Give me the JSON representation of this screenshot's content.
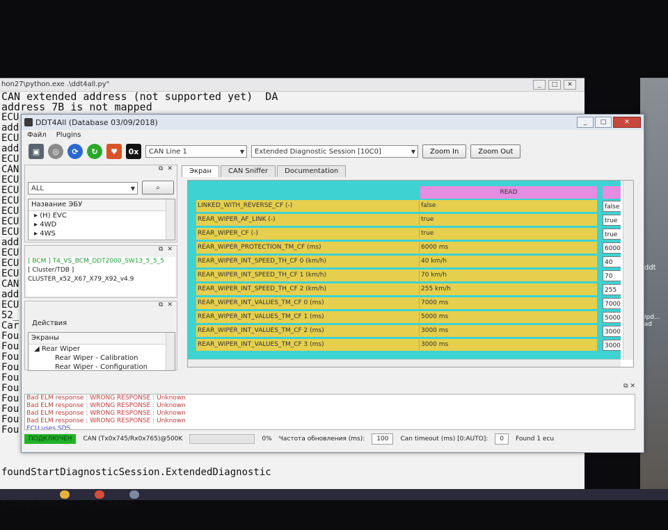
{
  "console": {
    "title": "hon27\\python.exe  .\\ddt4all.py\"",
    "lines": [
      "CAN extended address (not supported yet)  DA",
      "address 7B is not mapped",
      "ECU",
      "add",
      "ECU",
      "add",
      "ECU",
      "CAN",
      "ECU",
      "ECU",
      "ECU",
      "ECU",
      "ECU",
      "ECU",
      "add",
      "ECU",
      "ECU",
      "ECU",
      "CAN",
      "add",
      "ECU",
      "52_",
      "Car",
      "Fou",
      "Fou",
      "Fou",
      "Fou",
      "Fou",
      "Fou",
      "Fou",
      "Fou",
      "Fou",
      "Fou"
    ],
    "bottom_lines": [
      "foundStartDiagnosticSession.ExtendedDiagnostic",
      "foundCommand Soft Reset"
    ]
  },
  "side_text": {
    "a": "ddt",
    "b": "Upd... rad"
  },
  "window": {
    "title": "DDT4All (Database 03/09/2018)",
    "menu": [
      "Файл",
      "Plugins"
    ],
    "toolbar": {
      "icon_hex_label": "0x",
      "can_line": "CAN Line 1",
      "session": "Extended Diagnostic Session [10C0]",
      "zoom_in": "Zoom In",
      "zoom_out": "Zoom Out"
    },
    "ecu_filter": "ALL",
    "ecu_list": {
      "header": "Название ЭБУ",
      "items": [
        "(H) EVC",
        "4WD",
        "4WS"
      ]
    },
    "ecu_selected": [
      "[ BCM ] T4_VS_BCM_DDT2000_SW13_5_5_5",
      "[ Cluster/TDB ] CLUSTER_x52_X67_X79_X92_v4.9"
    ],
    "actions": {
      "title": "Действия",
      "header": "Экраны",
      "items": [
        "Rear Wiper",
        "Rear Wiper - Calibration",
        "Rear Wiper - Configuration"
      ]
    },
    "tabs": [
      "Экран",
      "CAN Sniffer",
      "Documentation"
    ],
    "screen": {
      "read_header": "READ",
      "params": [
        {
          "name": "LINKED_WITH_REVERSE_CF (-)",
          "value": "false",
          "edit": "false"
        },
        {
          "name": "REAR_WIPER_AF_LINK (-)",
          "value": "true",
          "edit": "true"
        },
        {
          "name": "REAR_WIPER_CF (-)",
          "value": "true",
          "edit": "true"
        },
        {
          "name": "REAR_WIPER_PROTECTION_TM_CF (ms)",
          "value": "6000 ms",
          "edit": "6000"
        },
        {
          "name": "REAR_WIPER_INT_SPEED_TH_CF 0 (km/h)",
          "value": "40 km/h",
          "edit": "40"
        },
        {
          "name": "REAR_WIPER_INT_SPEED_TH_CF 1 (km/h)",
          "value": "70 km/h",
          "edit": "70"
        },
        {
          "name": "REAR_WIPER_INT_SPEED_TH_CF 2 (km/h)",
          "value": "255 km/h",
          "edit": "255"
        },
        {
          "name": "REAR_WIPER_INT_VALUES_TM_CF 0 (ms)",
          "value": "7000 ms",
          "edit": "7000"
        },
        {
          "name": "REAR_WIPER_INT_VALUES_TM_CF 1 (ms)",
          "value": "5000 ms",
          "edit": "5000"
        },
        {
          "name": "REAR_WIPER_INT_VALUES_TM_CF 2 (ms)",
          "value": "3000 ms",
          "edit": "3000"
        },
        {
          "name": "REAR_WIPER_INT_VALUES_TM_CF 3 (ms)",
          "value": "3000 ms",
          "edit": "3000"
        }
      ]
    },
    "log": [
      {
        "text": "Bad ELM response : WRONG RESPONSE : Unknown",
        "kind": "err"
      },
      {
        "text": "Bad ELM response : WRONG RESPONSE : Unknown",
        "kind": "err"
      },
      {
        "text": "Bad ELM response : WRONG RESPONSE : Unknown",
        "kind": "err"
      },
      {
        "text": "Bad ELM response : WRONG RESPONSE : Unknown",
        "kind": "err"
      },
      {
        "text": "ECU uses SDS",
        "kind": "info"
      }
    ],
    "status": {
      "connection": "ПОДКЛЮЧЕН",
      "can": "CAN (Tx0x745/Rx0x765)@500K",
      "progress_pct": "0%",
      "refresh_label": "Частота обновления (ms):",
      "refresh_value": "100",
      "timeout_label": "Can timeout (ms) [0:AUTO]:",
      "timeout_value": "0",
      "found": "Found 1 ecu"
    }
  },
  "colors": {
    "canvas_bg": "#3ed2d2",
    "row_bg": "#e6cf4d",
    "read_header_bg": "#e58de0",
    "connected_green": "#22b02a"
  }
}
